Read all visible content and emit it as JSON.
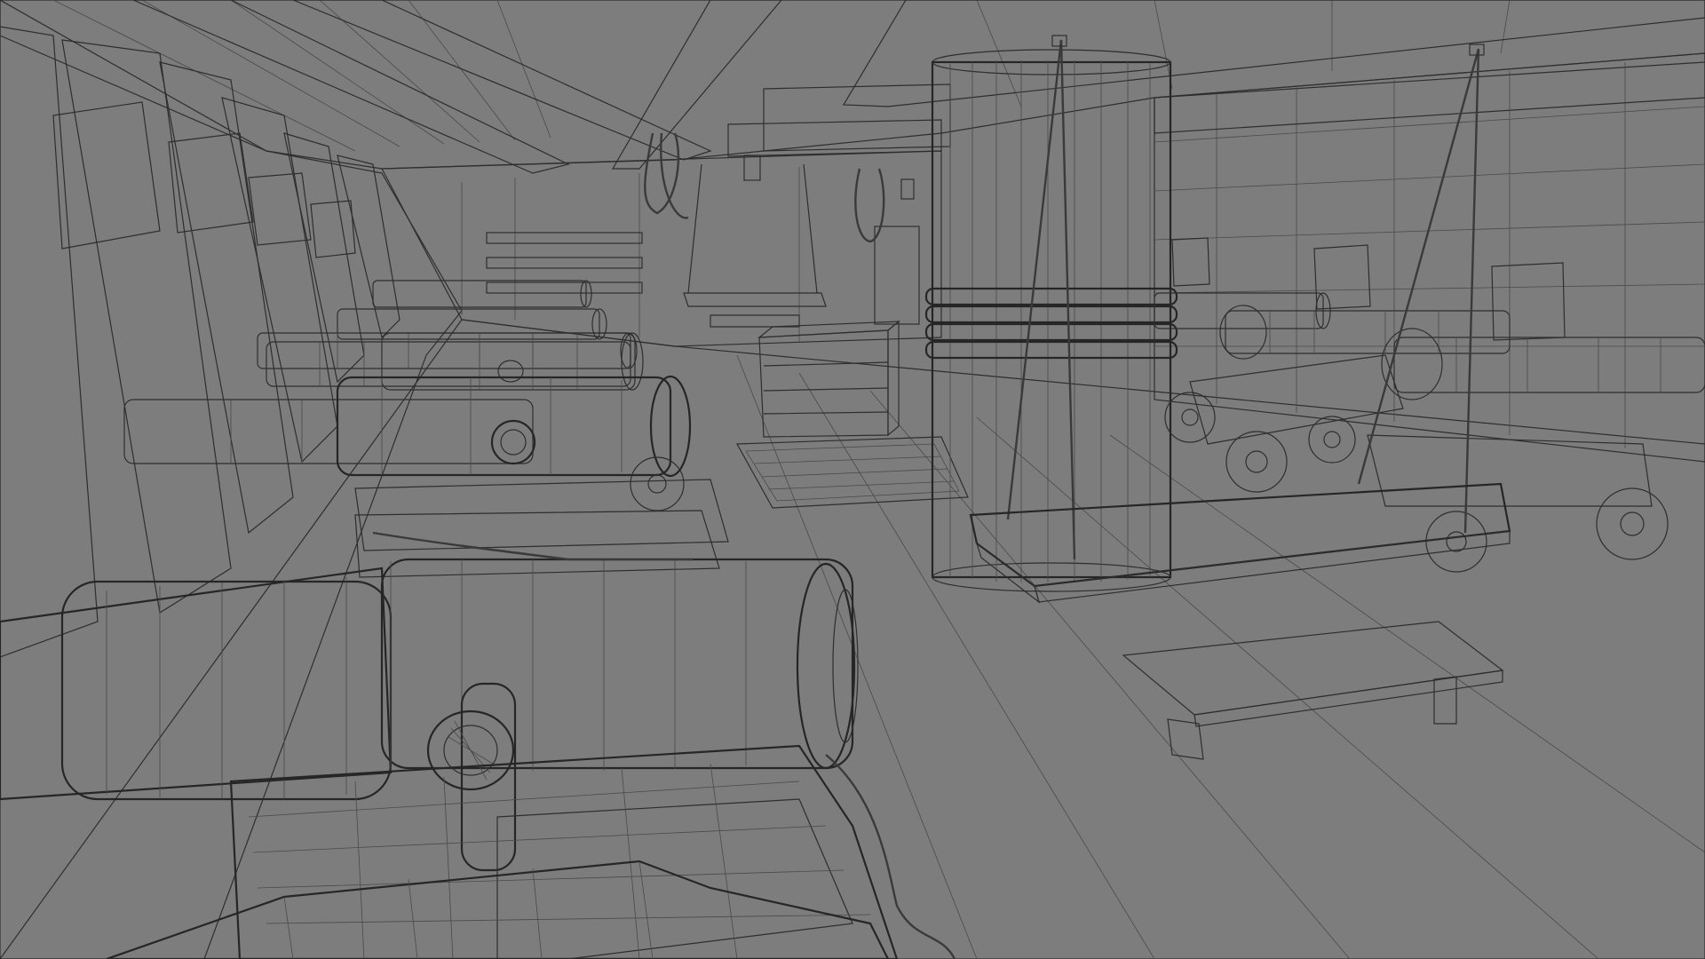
{
  "scene": {
    "kind": "3d-viewport-wireframe",
    "subject": "ship gun deck",
    "colors": {
      "floor": "#9a9a9a",
      "wall": "#8f8f8f",
      "wall_dark": "#6a6a6a",
      "ceiling": "#5a5a5a",
      "beam": "#7c7c7c",
      "metal": "#8c8c8c",
      "metal_light": "#a6a6a6",
      "wire": "#2e2e2e"
    }
  }
}
